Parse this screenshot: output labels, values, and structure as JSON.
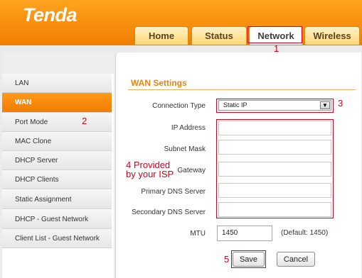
{
  "brand": {
    "logo_text": "Tenda"
  },
  "nav": {
    "tabs": [
      {
        "label": "Home"
      },
      {
        "label": "Status"
      },
      {
        "label": "Network"
      },
      {
        "label": "Wireless"
      }
    ],
    "active_tab": "Network"
  },
  "sidebar": {
    "items": [
      {
        "label": "LAN"
      },
      {
        "label": "WAN"
      },
      {
        "label": "Port Mode"
      },
      {
        "label": "MAC Clone"
      },
      {
        "label": "DHCP Server"
      },
      {
        "label": "DHCP Clients"
      },
      {
        "label": "Static Assignment"
      },
      {
        "label": "DHCP - Guest Network"
      },
      {
        "label": "Client List - Guest Network"
      }
    ],
    "active_item": "WAN"
  },
  "wan": {
    "title": "WAN Settings",
    "connection_type_label": "Connection Type",
    "connection_type_value": "Static IP",
    "ip_address_label": "IP Address",
    "subnet_mask_label": "Subnet Mask",
    "gateway_label": "Gateway",
    "primary_dns_label": "Primary DNS Server",
    "secondary_dns_label": "Secondary DNS Server",
    "mtu_label": "MTU",
    "mtu_value": "1450",
    "mtu_default": "(Default: 1450)",
    "save_label": "Save",
    "cancel_label": "Cancel"
  },
  "annotations": {
    "n1": "1",
    "n2": "2",
    "n3": "3",
    "n4_line1": "4 Provided",
    "n4_line2": "by your ISP",
    "n5": "5"
  },
  "colors": {
    "header_orange": "#f5880a",
    "title_orange": "#e8820c",
    "annotation_red": "#d0021b"
  }
}
